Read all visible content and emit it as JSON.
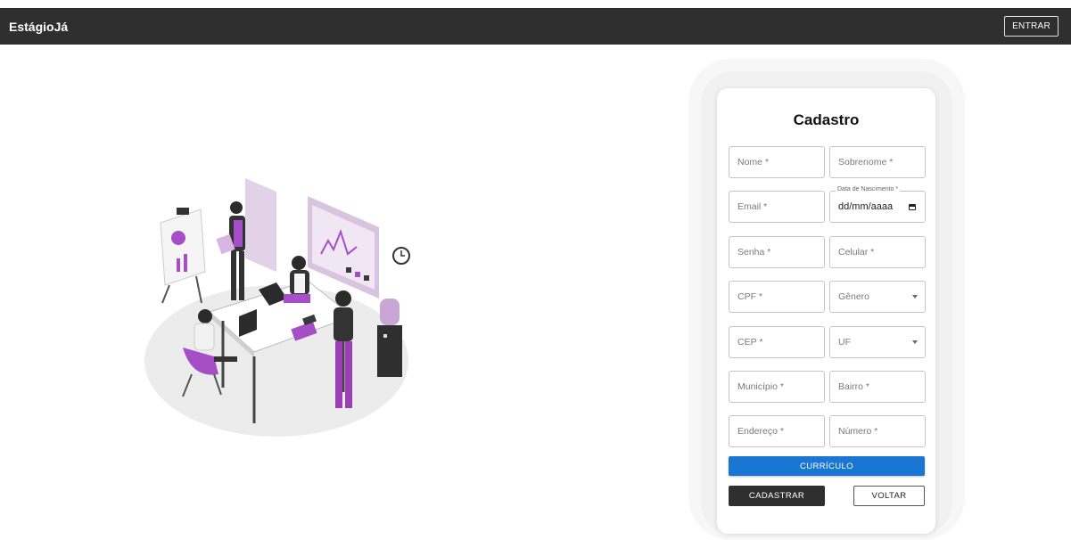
{
  "header": {
    "brand": "EstágioJá",
    "login_label": "ENTRAR"
  },
  "form": {
    "title": "Cadastro",
    "fields": {
      "nome": "Nome *",
      "sobrenome": "Sobrenome *",
      "email": "Email *",
      "nascimento_label": "Data de Nascimento *",
      "nascimento_value": "dd/mm/aaaa",
      "senha": "Senha *",
      "celular": "Celular *",
      "cpf": "CPF *",
      "genero": "Gênero",
      "cep": "CEP *",
      "uf": "UF",
      "municipio": "Município *",
      "bairro": "Bairro *",
      "endereco": "Endereço *",
      "numero": "Número *"
    },
    "curriculo_label": "CURRÍCULO",
    "cadastrar_label": "CADASTRAR",
    "voltar_label": "VOLTAR"
  },
  "colors": {
    "header_bg": "#2f2f2f",
    "primary_blue": "#1976d2",
    "accent_purple": "#a64ec6"
  }
}
